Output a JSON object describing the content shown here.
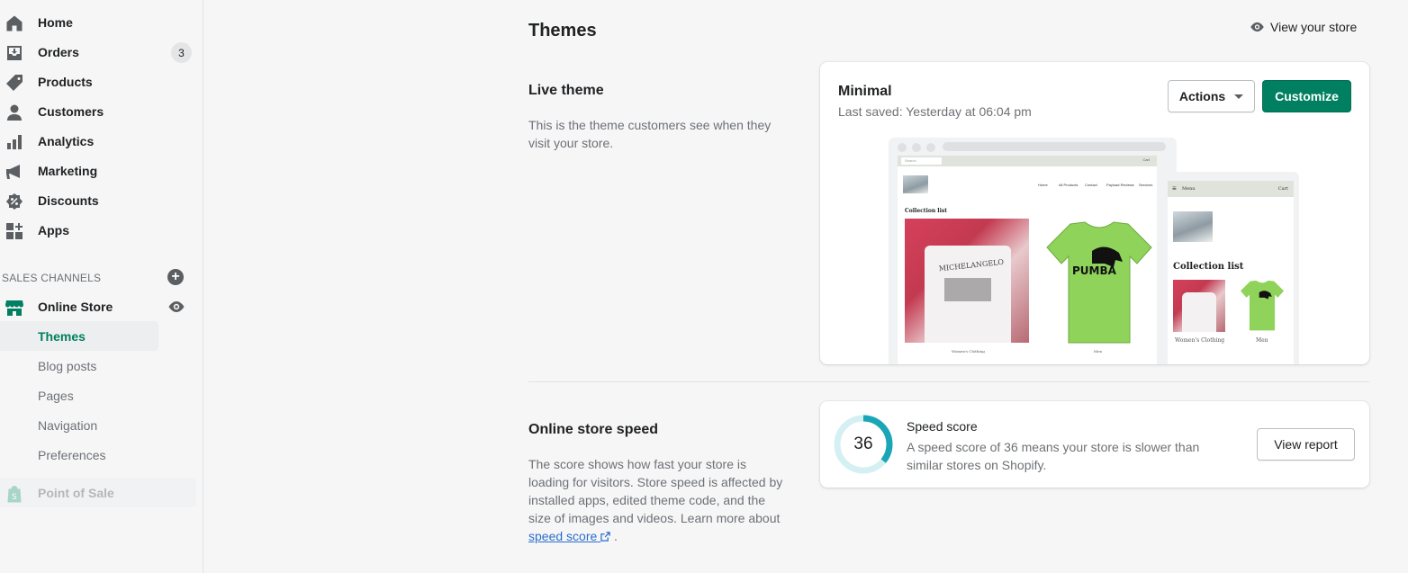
{
  "sidebar": {
    "items": [
      {
        "label": "Home",
        "icon": "home-icon"
      },
      {
        "label": "Orders",
        "icon": "orders-icon",
        "badge": "3"
      },
      {
        "label": "Products",
        "icon": "tag-icon"
      },
      {
        "label": "Customers",
        "icon": "person-icon"
      },
      {
        "label": "Analytics",
        "icon": "bar-chart-icon"
      },
      {
        "label": "Marketing",
        "icon": "megaphone-icon"
      },
      {
        "label": "Discounts",
        "icon": "discount-icon"
      },
      {
        "label": "Apps",
        "icon": "apps-icon"
      }
    ],
    "sales_channels_label": "SALES CHANNELS",
    "online_store": {
      "label": "Online Store",
      "subitems": [
        "Themes",
        "Blog posts",
        "Pages",
        "Navigation",
        "Preferences"
      ],
      "active": "Themes"
    },
    "point_of_sale": "Point of Sale"
  },
  "header": {
    "title": "Themes",
    "view_store": "View your store"
  },
  "live_theme": {
    "section_title": "Live theme",
    "section_desc": "This is the theme customers see when they visit your store.",
    "name": "Minimal",
    "last_saved": "Last saved: Yesterday at 06:04 pm",
    "actions_label": "Actions",
    "customize_label": "Customize",
    "preview": {
      "search": "Search",
      "cart": "Cart",
      "nav": [
        "Home",
        "All Products",
        "Contact",
        "Payload Reviews",
        "Services"
      ],
      "collection_title": "Collection list",
      "captions": [
        "Women's Clothing",
        "Men"
      ],
      "shirt_print_1": "MICHELANGELO",
      "shirt_print_2": "PUMBA",
      "mobile_menu": "Menu",
      "mobile_cart": "Cart"
    }
  },
  "speed": {
    "section_title": "Online store speed",
    "section_desc_before": "The score shows how fast your store is loading for visitors. Store speed is affected by installed apps, edited theme code, and the size of images and videos. Learn more about ",
    "link_text": "speed score",
    "section_desc_after": " .",
    "score": "36",
    "score_fraction": 0.36,
    "card_title": "Speed score",
    "card_desc": "A speed score of 36 means your store is slower than similar stores on Shopify.",
    "view_report_label": "View report"
  },
  "colors": {
    "primary": "#008060",
    "gauge": "#1aa6b7",
    "link": "#2c6ecb"
  }
}
